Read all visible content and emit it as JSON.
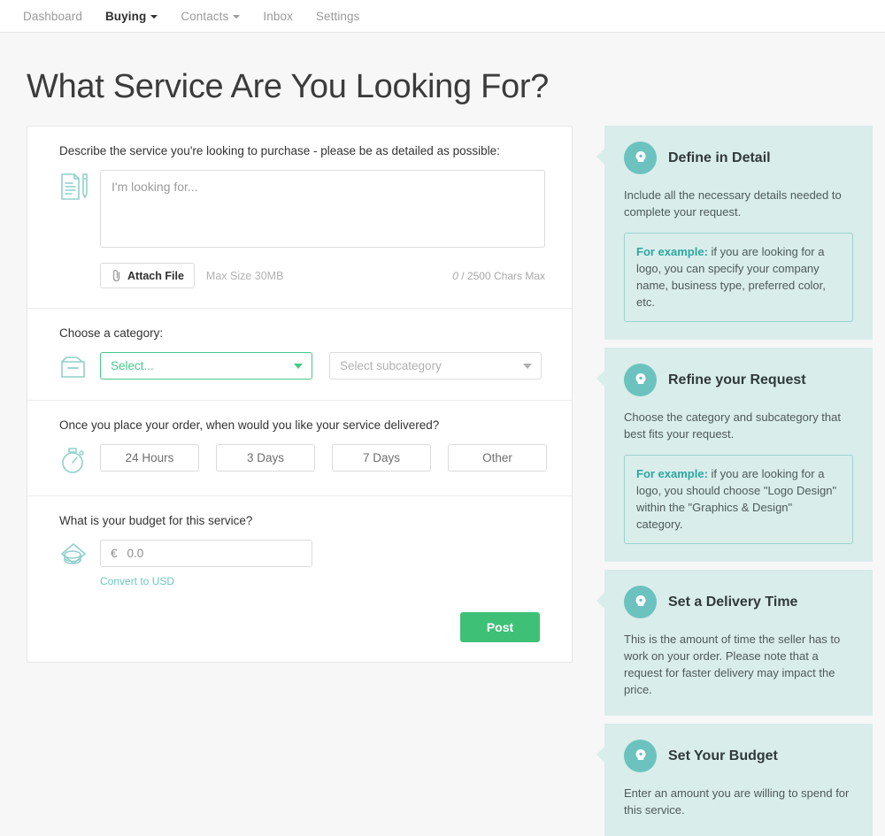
{
  "nav": {
    "items": [
      {
        "label": "Dashboard",
        "active": false,
        "caret": false
      },
      {
        "label": "Buying",
        "active": true,
        "caret": true
      },
      {
        "label": "Contacts",
        "active": false,
        "caret": true
      },
      {
        "label": "Inbox",
        "active": false,
        "caret": false
      },
      {
        "label": "Settings",
        "active": false,
        "caret": false
      }
    ]
  },
  "page": {
    "title": "What Service Are You Looking For?"
  },
  "form": {
    "describe": {
      "label": "Describe the service you're looking to purchase - please be as detailed as possible:",
      "placeholder": "I'm looking for...",
      "value": "",
      "attach_label": "Attach File",
      "max_size": "Max Size 30MB",
      "char_current": "0",
      "char_max": "/ 2500 Chars Max"
    },
    "category": {
      "label": "Choose a category:",
      "select_value": "Select...",
      "subcategory_value": "Select subcategory"
    },
    "delivery": {
      "label": "Once you place your order, when would you like your service delivered?",
      "options": [
        "24 Hours",
        "3 Days",
        "7 Days",
        "Other"
      ]
    },
    "budget": {
      "label": "What is your budget for this service?",
      "currency": "€",
      "placeholder": "0.0",
      "value": "",
      "convert_label": "Convert to USD"
    },
    "post_label": "Post"
  },
  "tips": [
    {
      "title": "Define in Detail",
      "body": "Include all the necessary details needed to complete your request.",
      "example_prefix": "For example:",
      "example": " if you are looking for a logo, you can specify your company name, business type, preferred color, etc."
    },
    {
      "title": "Refine your Request",
      "body": "Choose the category and subcategory that best fits your request.",
      "example_prefix": "For example:",
      "example": " if you are looking for a logo, you should choose \"Logo Design\" within the \"Graphics & Design\" category."
    },
    {
      "title": "Set a Delivery Time",
      "body": "This is the amount of time the seller has to work on your order. Please note that a request for faster delivery may impact the price.",
      "example_prefix": "",
      "example": ""
    },
    {
      "title": "Set Your Budget",
      "body": "Enter an amount you are willing to spend for this service.",
      "example_prefix": "",
      "example": ""
    }
  ],
  "colors": {
    "accent_green": "#3ec177",
    "accent_teal": "#6cc2bf",
    "tip_bg": "#d9edeb",
    "select_green": "#46c98b"
  }
}
